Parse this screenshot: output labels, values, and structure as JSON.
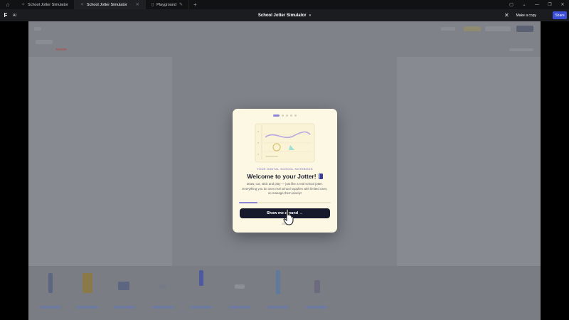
{
  "browser": {
    "tabs": [
      {
        "label": "School Jotter Simulator",
        "active": false
      },
      {
        "label": "School Jotter Simulator",
        "active": true
      },
      {
        "label": "Playground",
        "active": false
      }
    ]
  },
  "toolbar": {
    "ai_label": "AI",
    "document_title": "School Jotter Simulator",
    "make_copy_label": "Make a copy",
    "share_label": "Share"
  },
  "modal": {
    "eyebrow": "YOUR DIGITAL SCHOOL NOTEBOOK",
    "headline": "Welcome to your Jotter!",
    "body": "Draw, cut, stick and play — just like a real school jotter. Everything you do uses real school supplies with limited uses, so manage them wisely!",
    "step_current": 1,
    "step_total": 5,
    "cta_label": "Show me around →",
    "skip_label": "Skip"
  },
  "colors": {
    "accent": "#8f86d8",
    "share": "#3b4fd8",
    "cta": "#16192b",
    "modal_bg": "#fdf8e3"
  }
}
